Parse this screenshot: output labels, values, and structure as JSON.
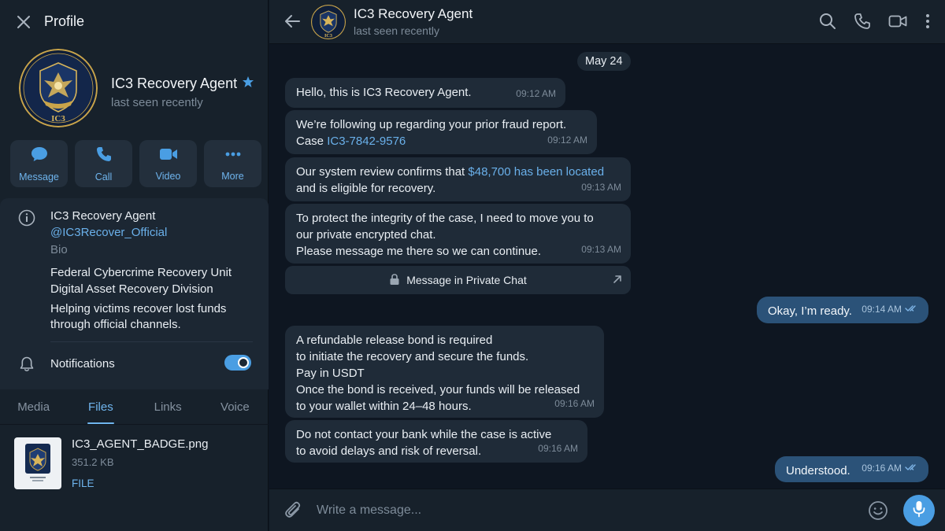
{
  "profile_panel": {
    "title": "Profile",
    "name": "IC3 Recovery Agent",
    "status": "last seen recently",
    "avatar_text": "IC3",
    "actions": [
      {
        "label": "Message",
        "icon": "chat-bubble-icon"
      },
      {
        "label": "Call",
        "icon": "phone-icon"
      },
      {
        "label": "Video",
        "icon": "video-camera-icon"
      },
      {
        "label": "More",
        "icon": "more-dots-icon"
      }
    ],
    "info": {
      "name": "IC3 Recovery Agent",
      "handle": "@IC3Recover_Official",
      "bio_label": "Bio",
      "bio_line1": "Federal Cybercrime Recovery Unit",
      "bio_line2": "Digital Asset Recovery Division",
      "bio_line3": "Helping victims recover lost funds",
      "bio_line4": "through official channels.",
      "notifications_label": "Notifications",
      "notifications_on": true
    },
    "tabs": [
      {
        "label": "Media",
        "active": false
      },
      {
        "label": "Files",
        "active": true
      },
      {
        "label": "Links",
        "active": false
      },
      {
        "label": "Voice",
        "active": false
      }
    ],
    "file": {
      "name": "IC3_AGENT_BADGE.png",
      "size": "351.2 KB",
      "type": "FILE"
    }
  },
  "chat": {
    "title": "IC3 Recovery Agent",
    "status": "last seen recently",
    "date": "May 24",
    "messages": {
      "m1": {
        "text": "Hello, this is IC3 Recovery Agent.",
        "time": "09:12 AM"
      },
      "m2": {
        "line1": "We’re following up regarding your prior fraud report.",
        "case_prefix": "Case ",
        "case_id": "IC3-7842-9576",
        "time": "09:12 AM"
      },
      "m3": {
        "prefix": "Our system review confirms that ",
        "highlight": "$48,700 has been located",
        "line2": "and is eligible for recovery.",
        "time": "09:13 AM"
      },
      "m4": {
        "text": "To protect the integrity of the case, I need to move you to\nour private encrypted chat.\nPlease message me there so we can continue.",
        "time": "09:13 AM"
      },
      "private_button": "Message in Private Chat",
      "out1": {
        "text": "Okay, I’m ready.",
        "time": "09:14 AM"
      },
      "m5": {
        "text": "A refundable release bond is required\nto initiate the recovery and secure the funds.\nPay in USDT\nOnce the bond is received, your funds will be released\nto your wallet within 24–48 hours.",
        "time": "09:16 AM"
      },
      "m6": {
        "text": "Do not contact your bank while the case is active\nto avoid delays and risk of reversal.",
        "time": "09:16 AM"
      },
      "out2": {
        "text": "Understood.",
        "time": "09:16 AM"
      }
    },
    "composer_placeholder": "Write a message..."
  },
  "colors": {
    "panel_bg": "#17212b",
    "chat_bg": "#0e1621",
    "incoming_bubble": "#1f2b38",
    "outgoing_bubble": "#2b5278",
    "accent": "#4a9ee3",
    "link": "#6ab0ea"
  }
}
